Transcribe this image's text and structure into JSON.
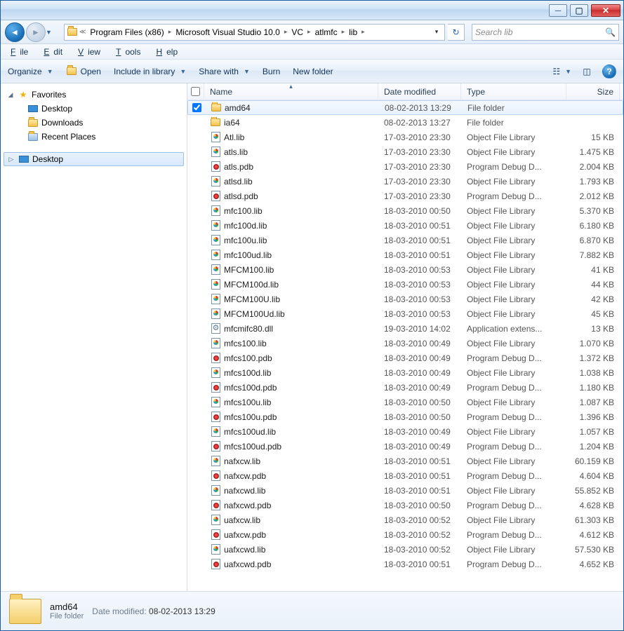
{
  "breadcrumb": [
    "Program Files (x86)",
    "Microsoft Visual Studio 10.0",
    "VC",
    "atlmfc",
    "lib"
  ],
  "search_placeholder": "Search lib",
  "menu": {
    "file": "File",
    "edit": "Edit",
    "view": "View",
    "tools": "Tools",
    "help": "Help"
  },
  "toolbar": {
    "organize": "Organize",
    "open": "Open",
    "include": "Include in library",
    "share": "Share with",
    "burn": "Burn",
    "newfolder": "New folder"
  },
  "nav": {
    "favorites": "Favorites",
    "desktop": "Desktop",
    "downloads": "Downloads",
    "recent": "Recent Places",
    "desktop_root": "Desktop"
  },
  "columns": {
    "name": "Name",
    "date": "Date modified",
    "type": "Type",
    "size": "Size"
  },
  "files": [
    {
      "sel": true,
      "icon": "folder",
      "name": "amd64",
      "date": "08-02-2013 13:29",
      "type": "File folder",
      "size": ""
    },
    {
      "sel": false,
      "icon": "folder",
      "name": "ia64",
      "date": "08-02-2013 13:27",
      "type": "File folder",
      "size": ""
    },
    {
      "sel": false,
      "icon": "lib",
      "name": "Atl.lib",
      "date": "17-03-2010 23:30",
      "type": "Object File Library",
      "size": "15 KB"
    },
    {
      "sel": false,
      "icon": "lib",
      "name": "atls.lib",
      "date": "17-03-2010 23:30",
      "type": "Object File Library",
      "size": "1.475 KB"
    },
    {
      "sel": false,
      "icon": "pdb",
      "name": "atls.pdb",
      "date": "17-03-2010 23:30",
      "type": "Program Debug D...",
      "size": "2.004 KB"
    },
    {
      "sel": false,
      "icon": "lib",
      "name": "atlsd.lib",
      "date": "17-03-2010 23:30",
      "type": "Object File Library",
      "size": "1.793 KB"
    },
    {
      "sel": false,
      "icon": "pdb",
      "name": "atlsd.pdb",
      "date": "17-03-2010 23:30",
      "type": "Program Debug D...",
      "size": "2.012 KB"
    },
    {
      "sel": false,
      "icon": "lib",
      "name": "mfc100.lib",
      "date": "18-03-2010 00:50",
      "type": "Object File Library",
      "size": "5.370 KB"
    },
    {
      "sel": false,
      "icon": "lib",
      "name": "mfc100d.lib",
      "date": "18-03-2010 00:51",
      "type": "Object File Library",
      "size": "6.180 KB"
    },
    {
      "sel": false,
      "icon": "lib",
      "name": "mfc100u.lib",
      "date": "18-03-2010 00:51",
      "type": "Object File Library",
      "size": "6.870 KB"
    },
    {
      "sel": false,
      "icon": "lib",
      "name": "mfc100ud.lib",
      "date": "18-03-2010 00:51",
      "type": "Object File Library",
      "size": "7.882 KB"
    },
    {
      "sel": false,
      "icon": "lib",
      "name": "MFCM100.lib",
      "date": "18-03-2010 00:53",
      "type": "Object File Library",
      "size": "41 KB"
    },
    {
      "sel": false,
      "icon": "lib",
      "name": "MFCM100d.lib",
      "date": "18-03-2010 00:53",
      "type": "Object File Library",
      "size": "44 KB"
    },
    {
      "sel": false,
      "icon": "lib",
      "name": "MFCM100U.lib",
      "date": "18-03-2010 00:53",
      "type": "Object File Library",
      "size": "42 KB"
    },
    {
      "sel": false,
      "icon": "lib",
      "name": "MFCM100Ud.lib",
      "date": "18-03-2010 00:53",
      "type": "Object File Library",
      "size": "45 KB"
    },
    {
      "sel": false,
      "icon": "dll",
      "name": "mfcmifc80.dll",
      "date": "19-03-2010 14:02",
      "type": "Application extens...",
      "size": "13 KB"
    },
    {
      "sel": false,
      "icon": "lib",
      "name": "mfcs100.lib",
      "date": "18-03-2010 00:49",
      "type": "Object File Library",
      "size": "1.070 KB"
    },
    {
      "sel": false,
      "icon": "pdb",
      "name": "mfcs100.pdb",
      "date": "18-03-2010 00:49",
      "type": "Program Debug D...",
      "size": "1.372 KB"
    },
    {
      "sel": false,
      "icon": "lib",
      "name": "mfcs100d.lib",
      "date": "18-03-2010 00:49",
      "type": "Object File Library",
      "size": "1.038 KB"
    },
    {
      "sel": false,
      "icon": "pdb",
      "name": "mfcs100d.pdb",
      "date": "18-03-2010 00:49",
      "type": "Program Debug D...",
      "size": "1.180 KB"
    },
    {
      "sel": false,
      "icon": "lib",
      "name": "mfcs100u.lib",
      "date": "18-03-2010 00:50",
      "type": "Object File Library",
      "size": "1.087 KB"
    },
    {
      "sel": false,
      "icon": "pdb",
      "name": "mfcs100u.pdb",
      "date": "18-03-2010 00:50",
      "type": "Program Debug D...",
      "size": "1.396 KB"
    },
    {
      "sel": false,
      "icon": "lib",
      "name": "mfcs100ud.lib",
      "date": "18-03-2010 00:49",
      "type": "Object File Library",
      "size": "1.057 KB"
    },
    {
      "sel": false,
      "icon": "pdb",
      "name": "mfcs100ud.pdb",
      "date": "18-03-2010 00:49",
      "type": "Program Debug D...",
      "size": "1.204 KB"
    },
    {
      "sel": false,
      "icon": "lib",
      "name": "nafxcw.lib",
      "date": "18-03-2010 00:51",
      "type": "Object File Library",
      "size": "60.159 KB"
    },
    {
      "sel": false,
      "icon": "pdb",
      "name": "nafxcw.pdb",
      "date": "18-03-2010 00:51",
      "type": "Program Debug D...",
      "size": "4.604 KB"
    },
    {
      "sel": false,
      "icon": "lib",
      "name": "nafxcwd.lib",
      "date": "18-03-2010 00:51",
      "type": "Object File Library",
      "size": "55.852 KB"
    },
    {
      "sel": false,
      "icon": "pdb",
      "name": "nafxcwd.pdb",
      "date": "18-03-2010 00:50",
      "type": "Program Debug D...",
      "size": "4.628 KB"
    },
    {
      "sel": false,
      "icon": "lib",
      "name": "uafxcw.lib",
      "date": "18-03-2010 00:52",
      "type": "Object File Library",
      "size": "61.303 KB"
    },
    {
      "sel": false,
      "icon": "pdb",
      "name": "uafxcw.pdb",
      "date": "18-03-2010 00:52",
      "type": "Program Debug D...",
      "size": "4.612 KB"
    },
    {
      "sel": false,
      "icon": "lib",
      "name": "uafxcwd.lib",
      "date": "18-03-2010 00:52",
      "type": "Object File Library",
      "size": "57.530 KB"
    },
    {
      "sel": false,
      "icon": "pdb",
      "name": "uafxcwd.pdb",
      "date": "18-03-2010 00:51",
      "type": "Program Debug D...",
      "size": "4.652 KB"
    }
  ],
  "details": {
    "name": "amd64",
    "type": "File folder",
    "meta_label": "Date modified:",
    "meta_value": "08-02-2013 13:29"
  }
}
